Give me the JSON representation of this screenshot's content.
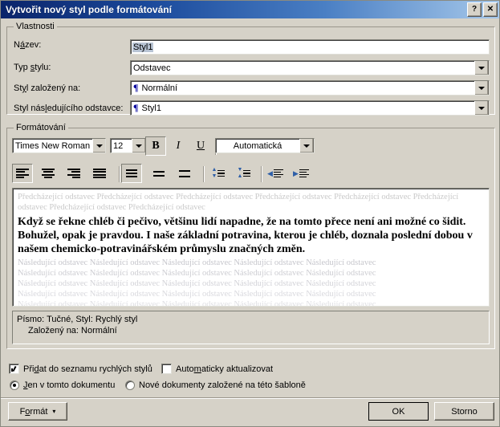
{
  "titlebar": {
    "title": "Vytvořit nový styl podle formátování",
    "help_label": "?",
    "close_label": "✕"
  },
  "properties": {
    "group_label": "Vlastnosti",
    "name_label_pre": "N",
    "name_label_acc": "á",
    "name_label_post": "zev:",
    "name_label": "Název:",
    "name_value": "Styl1",
    "type_label": "Typ stylu:",
    "type_value": "Odstavec",
    "based_label": "Styl založený na:",
    "based_value": "Normální",
    "next_label": "Styl následujícího odstavce:",
    "next_value": "Styl1",
    "pilcrow": "¶"
  },
  "formatting": {
    "group_label": "Formátování",
    "font_family": "Times New Roman",
    "font_size": "12",
    "bold_label": "B",
    "italic_label": "I",
    "underline_label": "U",
    "color_value": "Automatická",
    "align": [
      "Zarovnat vlevo",
      "Na střed",
      "Zarovnat vpravo",
      "Do bloku"
    ],
    "line_spacing": [
      "Jednoduché",
      "1,5 řádku",
      "Dvojité"
    ],
    "para_spacing": [
      "Zmenšit mezeru před odstavcem",
      "Zvětšit mezeru za odstavcem"
    ],
    "indent": [
      "Zmenšit odsazení",
      "Zvětšit odsazení"
    ]
  },
  "preview": {
    "before_text": "Předcházející odstavec Předcházející odstavec Předcházející odstavec Předcházející odstavec Předcházející odstavec Předcházející odstavec Předcházející odstavec Předcházející odstavec",
    "main_text": "Když se řekne chléb či pečivo, většinu lidí napadne, že na tomto přece není ani možné co šidit. Bohužel, opak je pravdou. I naše základní potravina, kterou je chléb, doznala poslední dobou v našem chemicko-potravinářském průmyslu značných změn.",
    "after_line": "Následující odstavec Následující odstavec Následující odstavec Následující odstavec Následující odstavec"
  },
  "description": {
    "line1": "Písmo: Tučné, Styl: Rychlý styl",
    "line2": "Založený na: Normální"
  },
  "options": {
    "add_quick_styles": "Přidat do seznamu rychlých stylů",
    "auto_update": "Automaticky aktualizovat",
    "this_document_only": "Jen v tomto dokumentu",
    "new_documents": "Nové dokumenty založené na této šabloně"
  },
  "footer": {
    "format_label": "Formát",
    "format_arrow": "▾",
    "ok_label": "OK",
    "cancel_label": "Storno"
  }
}
